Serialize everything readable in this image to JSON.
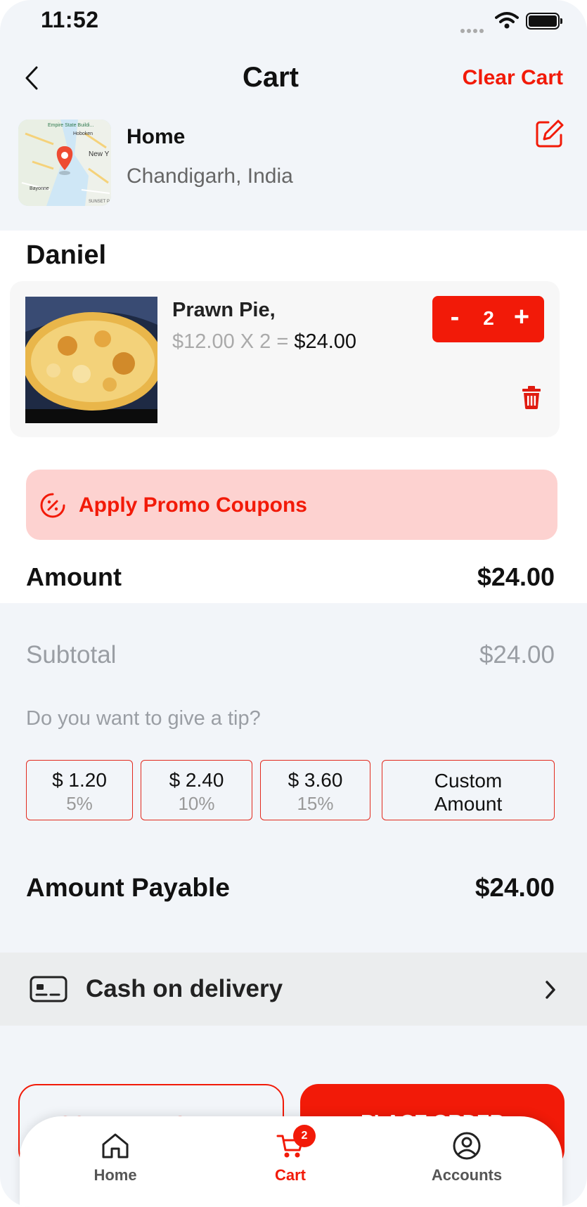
{
  "status_bar": {
    "time": "11:52"
  },
  "header": {
    "title": "Cart",
    "clear_label": "Clear Cart"
  },
  "address": {
    "label": "Home",
    "city": "Chandigarh, India",
    "map_text": {
      "empire": "Empire State Buildi...",
      "hoboken": "Hoboken",
      "newy": "New Y",
      "bayonne": "Bayonne",
      "sunset": "SUNSET P"
    }
  },
  "restaurant": {
    "name": "Daniel"
  },
  "item": {
    "name": "Prawn Pie,",
    "price_calc": "$12.00 X 2 = ",
    "line_total": "$24.00",
    "quantity": "2",
    "minus_label": "-",
    "plus_label": "+"
  },
  "promo": {
    "label": "Apply Promo Coupons"
  },
  "amount": {
    "label": "Amount",
    "value": "$24.00"
  },
  "subtotal": {
    "label": "Subtotal",
    "value": "$24.00"
  },
  "tip": {
    "question": "Do you want to give a tip?",
    "options": [
      {
        "amount": "$ 1.20",
        "percent": "5%"
      },
      {
        "amount": "$ 2.40",
        "percent": "10%"
      },
      {
        "amount": "$ 3.60",
        "percent": "15%"
      }
    ],
    "custom_line1": "Custom",
    "custom_line2": "Amount"
  },
  "payable": {
    "label": "Amount Payable",
    "value": "$24.00"
  },
  "payment": {
    "label": "Cash on delivery"
  },
  "actions": {
    "schedule_label": "SCHEDULE ORDER",
    "place_label": "PLACE ORDER"
  },
  "tabbar": {
    "home_label": "Home",
    "cart_label": "Cart",
    "accounts_label": "Accounts",
    "cart_badge": "2"
  },
  "colors": {
    "accent": "#f21a08",
    "promo_bg": "#fdd2d0",
    "page_bg": "#f2f5f9"
  },
  "icons": [
    "back-chevron-icon",
    "edit-icon",
    "trash-icon",
    "discount-icon",
    "cash-icon",
    "chevron-right-icon",
    "home-icon",
    "cart-icon",
    "account-icon",
    "wifi-icon",
    "battery-icon",
    "signal-icon"
  ]
}
